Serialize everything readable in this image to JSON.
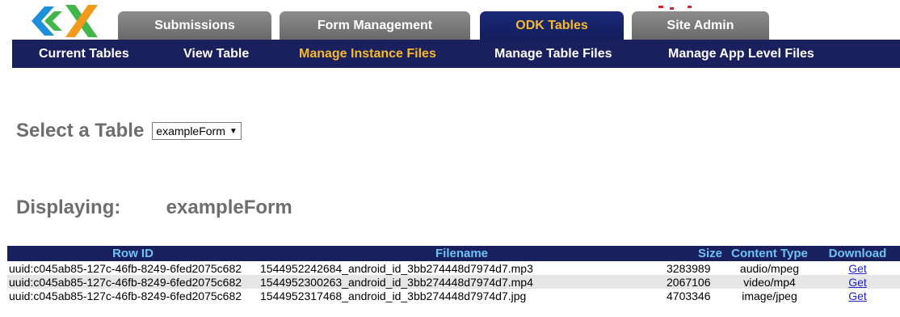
{
  "colors": {
    "nav_bg": "#1a1f5e",
    "active_text": "#f7ba2a",
    "header_text": "#6ec3f5",
    "tab_inactive": "#7a7a7a",
    "logo_blue": "#1c8fd8",
    "logo_green": "#43b649",
    "logo_orange": "#f39a1d"
  },
  "tabs": [
    {
      "label": "Submissions",
      "active": false
    },
    {
      "label": "Form Management",
      "active": false
    },
    {
      "label": "ODK Tables",
      "active": true
    },
    {
      "label": "Site Admin",
      "active": false
    }
  ],
  "subnav": [
    {
      "label": "Current Tables",
      "active": false
    },
    {
      "label": "View Table",
      "active": false
    },
    {
      "label": "Manage Instance Files",
      "active": true
    },
    {
      "label": "Manage Table Files",
      "active": false
    },
    {
      "label": "Manage App Level Files",
      "active": false
    }
  ],
  "select_table": {
    "label": "Select a Table",
    "selected": "exampleForm"
  },
  "displaying": {
    "label": "Displaying:",
    "value": "exampleForm"
  },
  "table": {
    "headers": [
      "Row ID",
      "Filename",
      "Size",
      "Content Type",
      "Download"
    ],
    "rows": [
      [
        "uuid:c045ab85-127c-46fb-8249-6fed2075c682",
        "1544952242684_android_id_3bb274448d7974d7.mp3",
        "3283989",
        "audio/mpeg",
        "Get"
      ],
      [
        "uuid:c045ab85-127c-46fb-8249-6fed2075c682",
        "1544952300263_android_id_3bb274448d7974d7.mp4",
        "2067106",
        "video/mp4",
        "Get"
      ],
      [
        "uuid:c045ab85-127c-46fb-8249-6fed2075c682",
        "1544952317468_android_id_3bb274448d7974d7.jpg",
        "4703346",
        "image/jpeg",
        "Get"
      ]
    ]
  }
}
